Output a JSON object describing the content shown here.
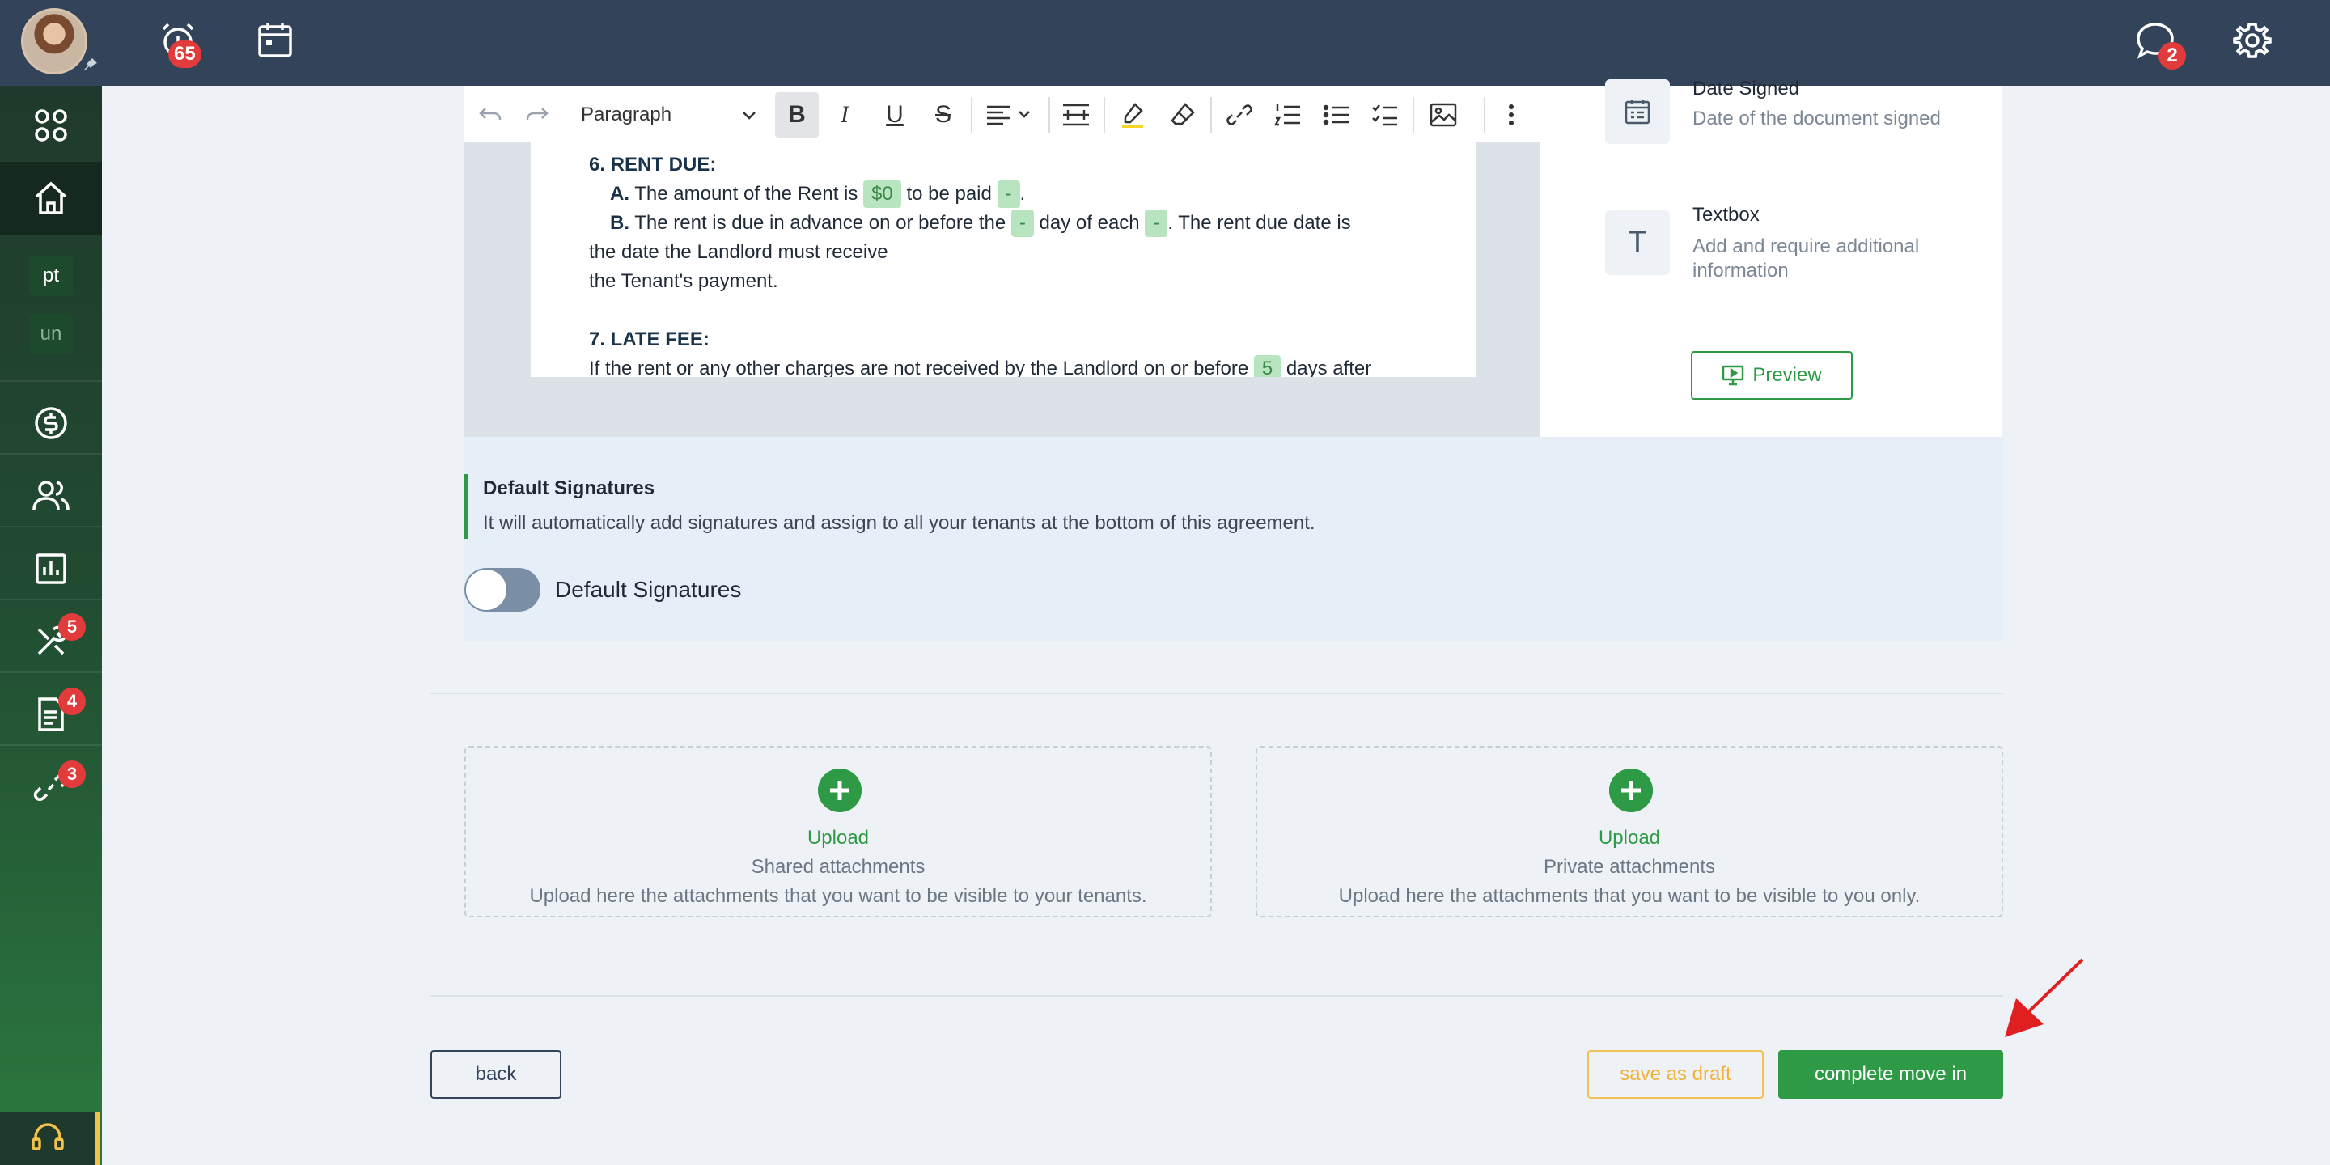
{
  "topbar": {
    "notifications_count": "65",
    "messages_count": "2"
  },
  "sidebar": {
    "chips": [
      "pt",
      "un"
    ],
    "badges": {
      "maintenance": "5",
      "documents": "4",
      "links": "3"
    }
  },
  "editor": {
    "paragraph_style": "Paragraph",
    "lines": {
      "l1_label": "6. RENT DUE:",
      "l2_label": "A.",
      "l2_text1": "The amount of the Rent is",
      "l2_tag1": "$0",
      "l2_text2": "to be paid",
      "l2_tag2": "-",
      "l2_end": ".",
      "l3_label": "B.",
      "l3_text1": "The rent is due in advance on or before the",
      "l3_tag1": "-",
      "l3_text2": "day of each",
      "l3_tag2": "-",
      "l3_text3": ". The rent due date is",
      "l4": "the date the Landlord must receive",
      "l5": "the Tenant's payment.",
      "l6_label": "7. LATE FEE:",
      "l7_text1": "If the rent or any other charges are not received by the Landlord on or before",
      "l7_tag1": "5",
      "l7_text2": "days after"
    }
  },
  "fields_panel": {
    "date_signed_title": "Date Signed",
    "date_signed_desc": "Date of the document signed",
    "textbox_title": "Textbox",
    "textbox_icon": "T",
    "textbox_desc": "Add and require additional information",
    "preview_label": "Preview"
  },
  "signatures": {
    "title": "Default Signatures",
    "description": "It will automatically add signatures and assign to all your tenants at the bottom of this agreement.",
    "toggle_label": "Default Signatures"
  },
  "uploads": [
    {
      "link": "Upload",
      "title": "Shared attachments",
      "description": "Upload here the attachments that you want to be visible to your tenants."
    },
    {
      "link": "Upload",
      "title": "Private attachments",
      "description": "Upload here the attachments that you want to be visible to you only."
    }
  ],
  "actions": {
    "back": "back",
    "save_draft": "save as draft",
    "complete": "complete move in"
  },
  "colors": {
    "topbar": "#33435a",
    "accent_green": "#2f9a45",
    "badge_red": "#e23b3b",
    "draft_yellow": "#f0b23a"
  }
}
